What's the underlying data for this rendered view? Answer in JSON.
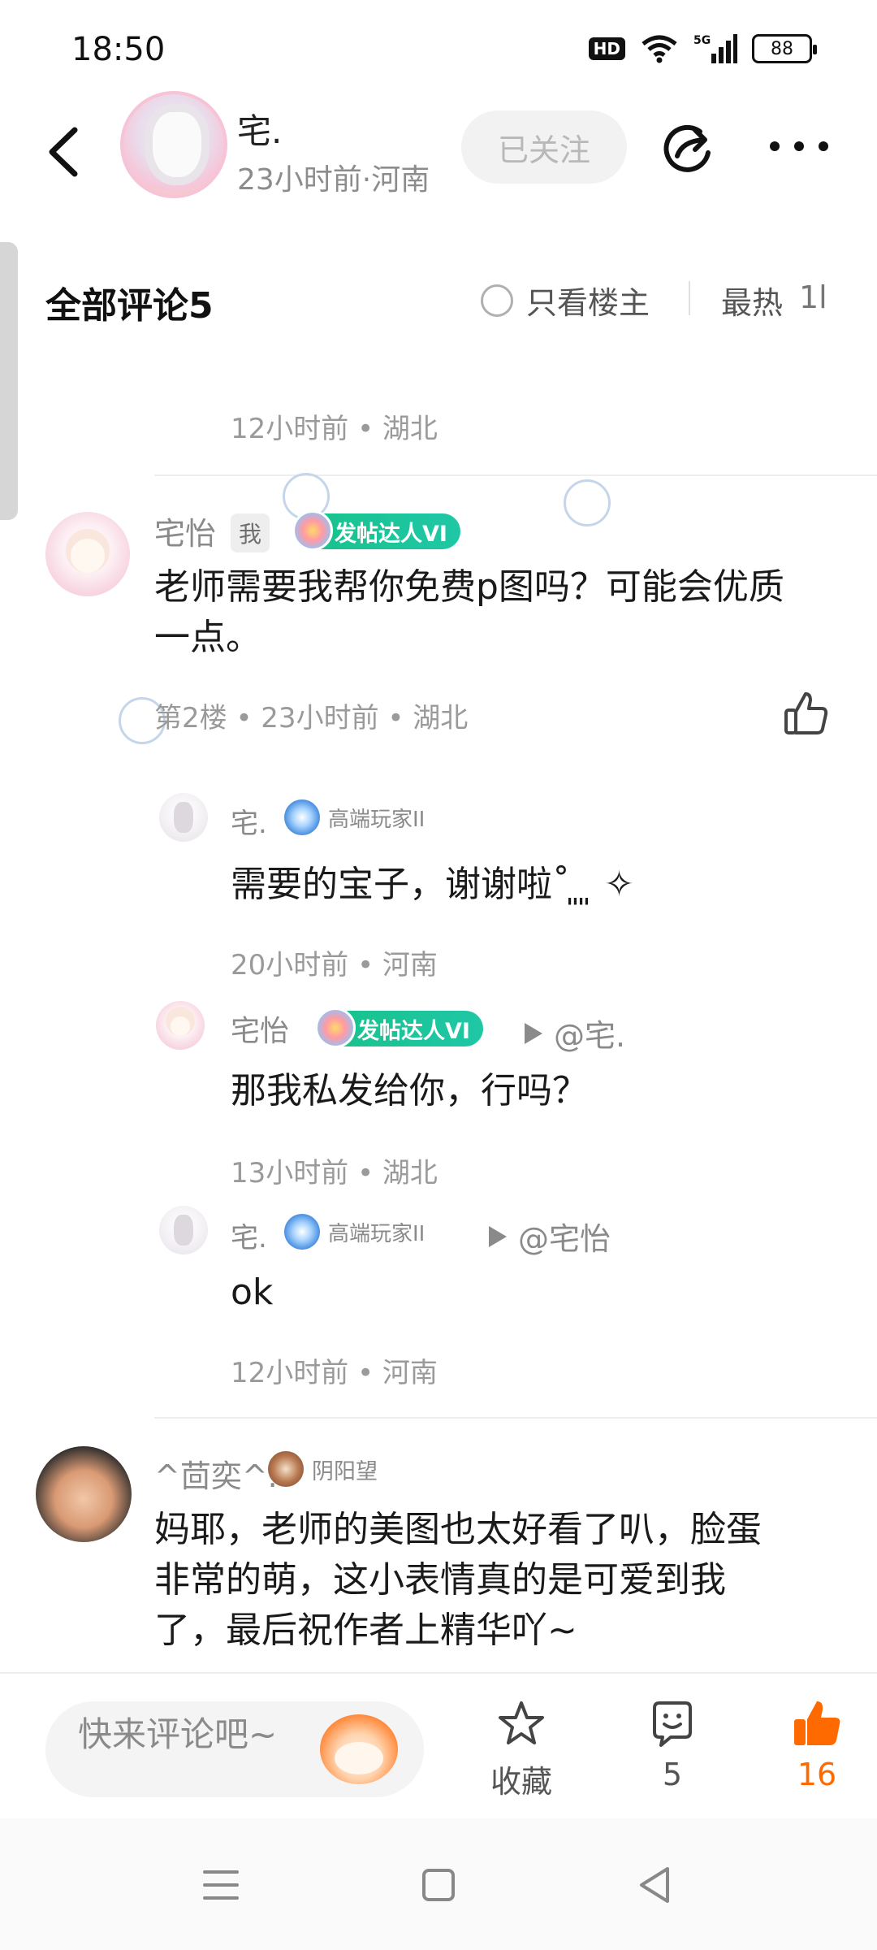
{
  "status_bar": {
    "time": "18:50",
    "hd": "HD",
    "signal": "5G",
    "battery": "88"
  },
  "header": {
    "author_name": "宅.",
    "author_meta": "23小时前·河南",
    "follow_label": "已关注"
  },
  "comments_header": {
    "title": "全部评论5",
    "owner_only": "只看楼主",
    "sort": "最热",
    "sort_icon": "1l"
  },
  "prev_tail": {
    "meta": "12小时前 • 湖北"
  },
  "comment2": {
    "name": "宅怡",
    "me_tag": "我",
    "badge": "发帖达人VI",
    "text_line1": "老师需要我帮你免费p图吗？可能会优质",
    "text_line2": "一点。",
    "meta": "第2楼 • 23小时前 • 湖北",
    "replies": [
      {
        "name": "宅.",
        "badge": "高端玩家II",
        "reply_to": "",
        "text": "需要的宝子，谢谢啦˚ ͈ ͈ ✧",
        "meta": "20小时前 • 河南"
      },
      {
        "name": "宅怡",
        "badge": "发帖达人VI",
        "reply_to": "@宅.",
        "text": "那我私发给你，行吗？",
        "meta": "13小时前 • 湖北"
      },
      {
        "name": "宅.",
        "badge": "高端玩家II",
        "reply_to": "@宅怡",
        "text": "ok",
        "meta": "12小时前 • 河南"
      }
    ]
  },
  "comment3": {
    "name": "^茴奕^.",
    "badge": "阴阳望",
    "text_line1": "妈耶，老师的美图也太好看了叭，脸蛋",
    "text_line2": "非常的萌，这小表情真的是可爱到我",
    "text_line3": "了，最后祝作者上精华吖~"
  },
  "bottom_bar": {
    "input_placeholder": "快来评论吧~",
    "favorite_label": "收藏",
    "comment_count": "5",
    "like_count": "16",
    "accent_color": "#ff6a00"
  }
}
